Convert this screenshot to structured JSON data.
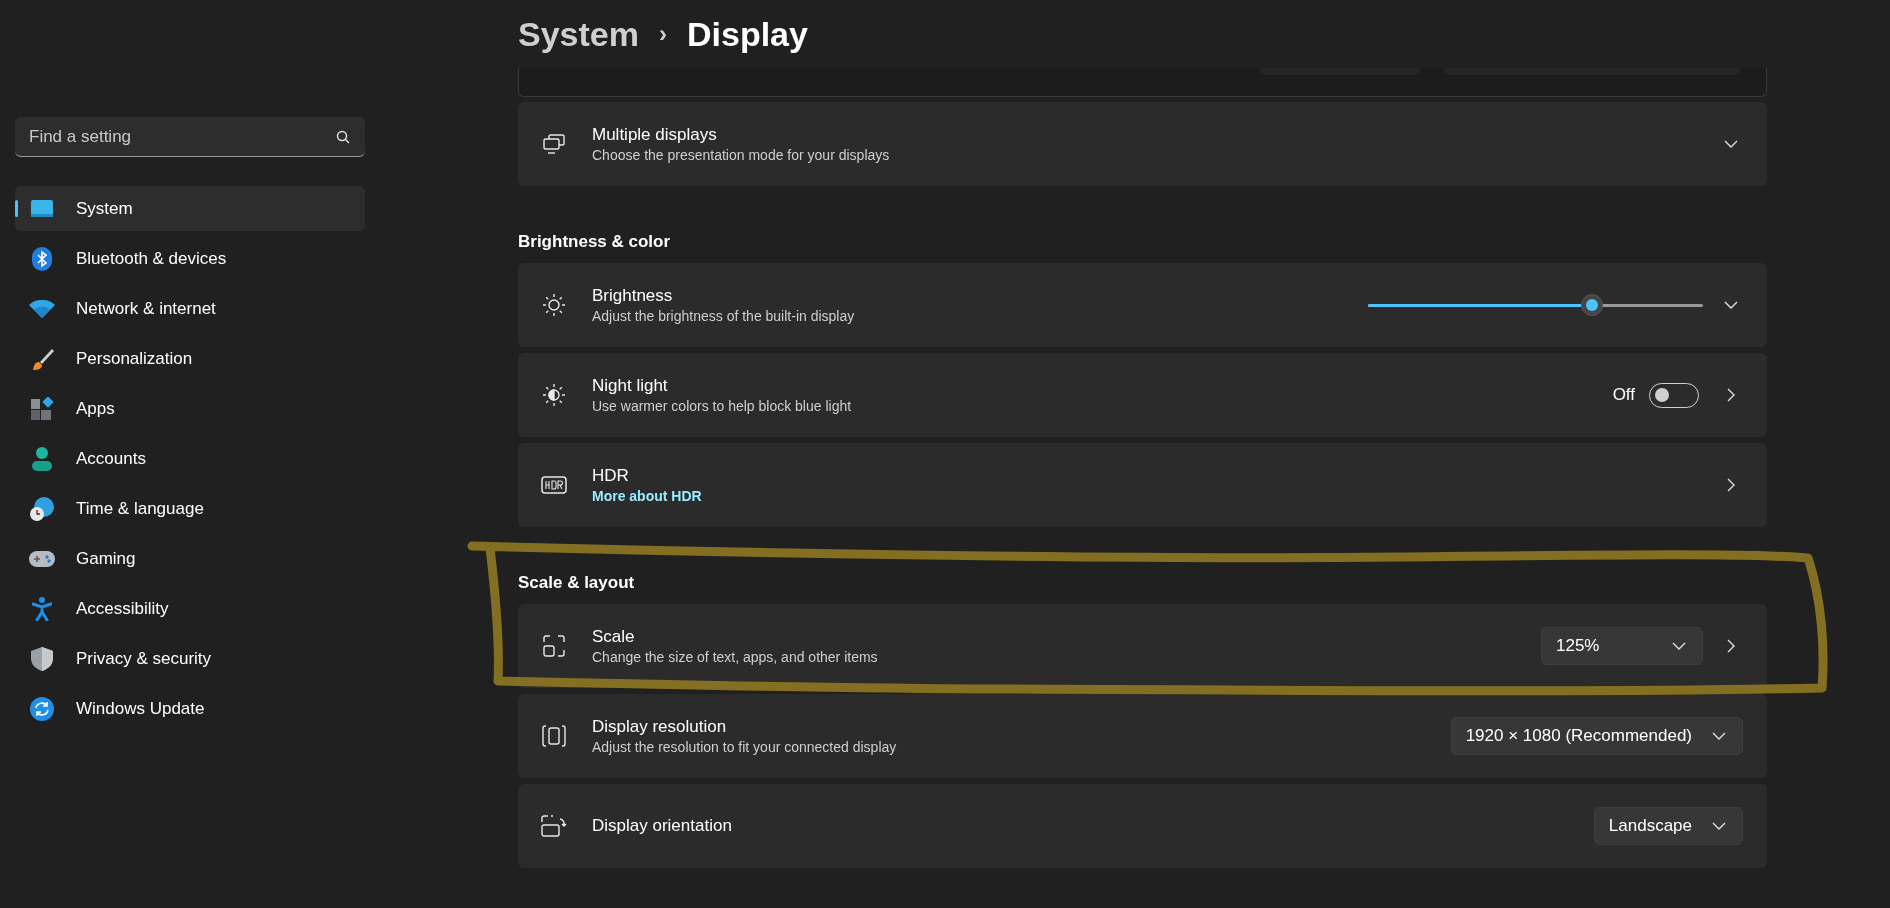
{
  "breadcrumb": {
    "parent": "System",
    "separator": "›",
    "current": "Display"
  },
  "search": {
    "placeholder": "Find a setting"
  },
  "sidebar": {
    "items": [
      {
        "label": "System",
        "selected": true
      },
      {
        "label": "Bluetooth & devices",
        "selected": false
      },
      {
        "label": "Network & internet",
        "selected": false
      },
      {
        "label": "Personalization",
        "selected": false
      },
      {
        "label": "Apps",
        "selected": false
      },
      {
        "label": "Accounts",
        "selected": false
      },
      {
        "label": "Time & language",
        "selected": false
      },
      {
        "label": "Gaming",
        "selected": false
      },
      {
        "label": "Accessibility",
        "selected": false
      },
      {
        "label": "Privacy & security",
        "selected": false
      },
      {
        "label": "Windows Update",
        "selected": false
      }
    ]
  },
  "sections": [
    {
      "cards": [
        {
          "kind": "plain",
          "title": "Multiple displays",
          "subtitle": "Choose the presentation mode for your displays",
          "expand_button": true
        }
      ]
    },
    {
      "heading": "Brightness & color",
      "cards": [
        {
          "kind": "slider",
          "title": "Brightness",
          "subtitle": "Adjust the brightness of the built-in display",
          "level": 0.67,
          "expand_button": true
        },
        {
          "kind": "toggle",
          "title": "Night light",
          "subtitle": "Use warmer colors to help block blue light",
          "state_label": "Off",
          "on": false,
          "nav_arrow": true
        },
        {
          "kind": "plain",
          "title": "HDR",
          "link": "More about HDR",
          "nav_arrow": true
        }
      ]
    },
    {
      "heading": "Scale & layout",
      "cards": [
        {
          "kind": "dropdown",
          "title": "Scale",
          "subtitle": "Change the size of text, apps, and other items",
          "value": "125%",
          "nav_arrow": true
        },
        {
          "kind": "dropdown",
          "title": "Display resolution",
          "subtitle": "Adjust the resolution to fit your connected display",
          "value": "1920 × 1080 (Recommended)"
        },
        {
          "kind": "dropdown",
          "title": "Display orientation",
          "value": "Landscape"
        }
      ]
    }
  ]
}
